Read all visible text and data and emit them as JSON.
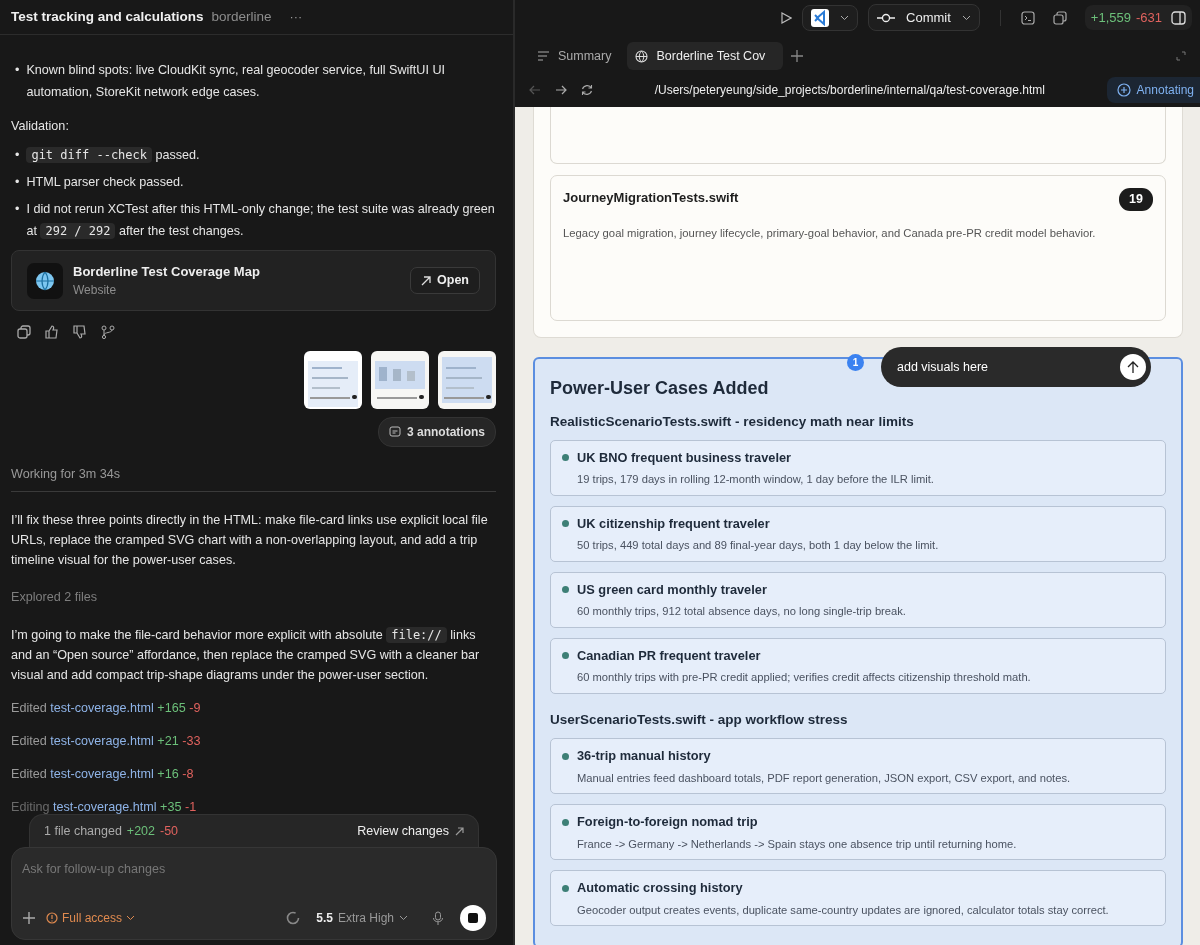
{
  "header": {
    "title": "Test tracking and calculations",
    "project": "borderline",
    "more": "···",
    "commit_label": "Commit",
    "diff_added": "+1,559",
    "diff_removed": "-631"
  },
  "conversation": {
    "bullets_top": [
      {
        "marker": "•",
        "parts": [
          {
            "kind": "text",
            "text": "Known blind spots: live CloudKit sync, real geocoder service, full SwiftUI UI automation, StoreKit network edge cases."
          }
        ]
      }
    ],
    "validation_label": "Validation:",
    "validation": [
      {
        "marker": "•",
        "parts": [
          {
            "kind": "code",
            "text": "git diff --check"
          },
          {
            "kind": "text",
            "text": " passed."
          }
        ]
      },
      {
        "marker": "•",
        "parts": [
          {
            "kind": "text",
            "text": "HTML parser check passed."
          }
        ]
      },
      {
        "marker": "•",
        "parts": [
          {
            "kind": "text",
            "text": "I did not rerun XCTest after this HTML-only change; the test suite was already green at "
          },
          {
            "kind": "code",
            "text": "292 / 292"
          },
          {
            "kind": "text",
            "text": " after the test changes."
          }
        ]
      }
    ],
    "link_card": {
      "title": "Borderline Test Coverage Map",
      "subtitle": "Website",
      "button": "Open"
    },
    "annotations_button": "3 annotations",
    "working": "Working for 3m 34s",
    "messages": [
      {
        "kind": "paragraph",
        "parts": [
          {
            "kind": "text",
            "text": "I’ll fix these three points directly in the HTML: make file-card links use explicit local file URLs, replace the cramped SVG chart with a non-overlapping layout, and add a trip timeline visual for the power-user cases."
          }
        ]
      },
      {
        "kind": "status",
        "parts": [
          {
            "kind": "text",
            "text": "Explored 2 files"
          }
        ]
      },
      {
        "kind": "paragraph",
        "parts": [
          {
            "kind": "text",
            "text": "I’m going to make the file-card behavior more explicit with absolute "
          },
          {
            "kind": "code",
            "text": "file://"
          },
          {
            "kind": "text",
            "text": " links and an “Open source” affordance, then replace the cramped SVG with a cleaner bar visual and add compact trip-shape diagrams under the power-user section."
          }
        ]
      }
    ],
    "edits": [
      {
        "verb": "Edited",
        "file": "test-coverage.html",
        "added": "+165",
        "removed": "-9",
        "in_progress": false
      },
      {
        "verb": "Edited",
        "file": "test-coverage.html",
        "added": "+21",
        "removed": "-33",
        "in_progress": false
      },
      {
        "verb": "Edited",
        "file": "test-coverage.html",
        "added": "+16",
        "removed": "-8",
        "in_progress": false
      },
      {
        "verb": "Editing",
        "file": "test-coverage.html",
        "added": "+35",
        "removed": "-1",
        "in_progress": true
      }
    ],
    "changes_bar": {
      "summary": "1 file changed",
      "added": "+202",
      "removed": "-50",
      "review": "Review changes"
    },
    "composer": {
      "placeholder": "Ask for follow-up changes",
      "access": "Full access",
      "model": "5.5",
      "effort": "Extra High"
    }
  },
  "browser": {
    "tabs": [
      {
        "label": "Summary",
        "kind": "summary",
        "selected": false
      },
      {
        "label": "Borderline Test Cov",
        "kind": "web",
        "selected": true
      }
    ],
    "url": "/Users/peteryeung/side_projects/borderline/internal/qa/test-coverage.html",
    "annotating_button": "Annotating",
    "file_cards": [
      {
        "title": "JourneyMigrationTests.swift",
        "count": "19",
        "description": "Legacy goal migration, journey lifecycle, primary-goal behavior, and Canada pre-PR credit model behavior."
      }
    ],
    "section": {
      "title": "Power-User Cases Added",
      "marker": "1",
      "comment": "add visuals here",
      "groups": [
        {
          "heading": "RealisticScenarioTests.swift - residency math near limits",
          "cases": [
            {
              "title": "UK BNO frequent business traveler",
              "description": "19 trips, 179 days in rolling 12-month window, 1 day before the ILR limit."
            },
            {
              "title": "UK citizenship frequent traveler",
              "description": "50 trips, 449 total days and 89 final-year days, both 1 day below the limit."
            },
            {
              "title": "US green card monthly traveler",
              "description": "60 monthly trips, 912 total absence days, no long single-trip break."
            },
            {
              "title": "Canadian PR frequent traveler",
              "description": "60 monthly trips with pre-PR credit applied; verifies credit affects citizenship threshold math."
            }
          ]
        },
        {
          "heading": "UserScenarioTests.swift - app workflow stress",
          "cases": [
            {
              "title": "36-trip manual history",
              "description": "Manual entries feed dashboard totals, PDF report generation, JSON export, CSV export, and notes."
            },
            {
              "title": "Foreign-to-foreign nomad trip",
              "description": "France -> Germany -> Netherlands -> Spain stays one absence trip until returning home."
            },
            {
              "title": "Automatic crossing history",
              "description": "Geocoder output creates events, duplicate same-country updates are ignored, calculator totals stay correct."
            }
          ]
        }
      ]
    }
  }
}
